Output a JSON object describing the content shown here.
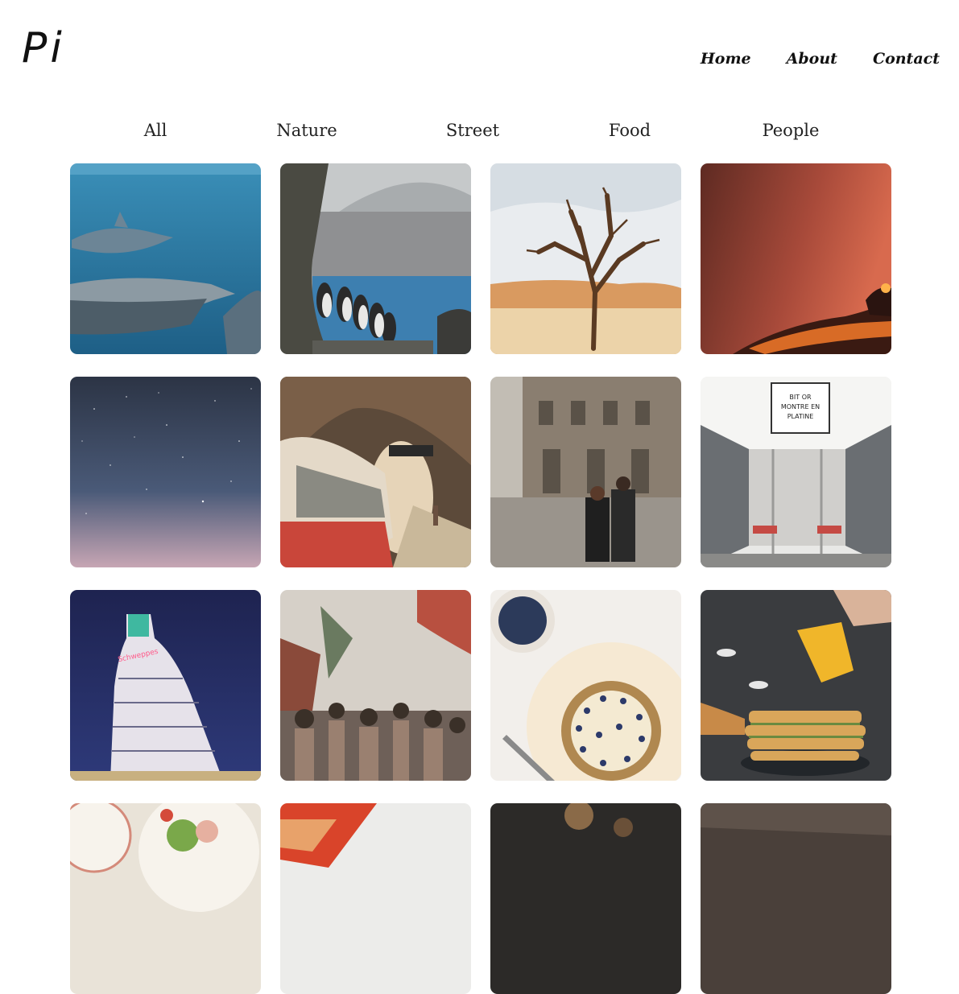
{
  "brand": {
    "logo": "Pi"
  },
  "nav": [
    {
      "id": "home",
      "label": "Home"
    },
    {
      "id": "about",
      "label": "About"
    },
    {
      "id": "contact",
      "label": "Contact"
    }
  ],
  "filters": [
    {
      "id": "all",
      "label": "All"
    },
    {
      "id": "nature",
      "label": "Nature"
    },
    {
      "id": "street",
      "label": "Street"
    },
    {
      "id": "food",
      "label": "Food"
    },
    {
      "id": "people",
      "label": "People"
    }
  ],
  "gallery": [
    {
      "name": "dolphins-photo"
    },
    {
      "name": "penguins-photo"
    },
    {
      "name": "desert-tree-photo"
    },
    {
      "name": "lava-photo"
    },
    {
      "name": "night-sky-photo"
    },
    {
      "name": "subway-train-photo"
    },
    {
      "name": "city-couple-photo"
    },
    {
      "name": "train-interior-photo",
      "sign_text": "BIT OR MONTRE EN PLATINE"
    },
    {
      "name": "schweppes-building-photo",
      "sign_text": "Schweppes"
    },
    {
      "name": "market-crowd-photo"
    },
    {
      "name": "blueberry-tart-photo"
    },
    {
      "name": "pancake-stack-photo"
    },
    {
      "name": "salad-plate-photo"
    },
    {
      "name": "pizza-photo"
    },
    {
      "name": "dark-food-photo"
    },
    {
      "name": "dark-table-photo"
    }
  ]
}
